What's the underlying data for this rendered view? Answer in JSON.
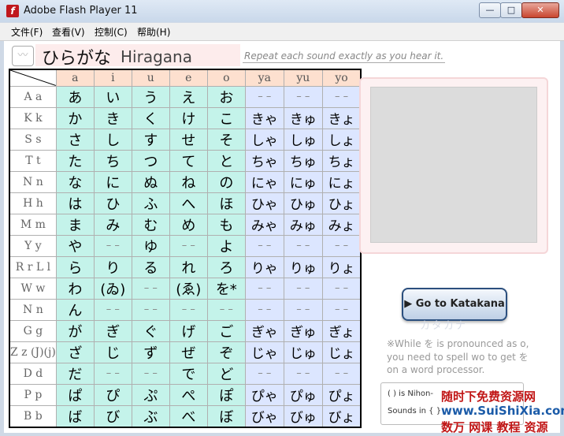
{
  "window": {
    "title": "Adobe Flash Player 11",
    "app_icon": "f",
    "min": "—",
    "max": "□",
    "close": "✕"
  },
  "menu": [
    "文件(F)",
    "查看(V)",
    "控制(C)",
    "帮助(H)"
  ],
  "header": {
    "icon": "〰",
    "title_kana": "ひらがな",
    "title_latin": "Hiragana",
    "instruction": "Repeat each sound exactly as you hear it."
  },
  "table": {
    "columns": [
      "a",
      "i",
      "u",
      "e",
      "o",
      "ya",
      "yu",
      "yo"
    ],
    "rows": [
      {
        "label": "A a",
        "cells": [
          "あ",
          "い",
          "う",
          "え",
          "お",
          "– –",
          "– –",
          "– –"
        ]
      },
      {
        "label": "K k",
        "cells": [
          "か",
          "き",
          "く",
          "け",
          "こ",
          "きゃ",
          "きゅ",
          "きょ"
        ]
      },
      {
        "label": "S s",
        "cells": [
          "さ",
          "し",
          "す",
          "せ",
          "そ",
          "しゃ",
          "しゅ",
          "しょ"
        ]
      },
      {
        "label": "T t",
        "cells": [
          "た",
          "ち",
          "つ",
          "て",
          "と",
          "ちゃ",
          "ちゅ",
          "ちょ"
        ]
      },
      {
        "label": "N n",
        "cells": [
          "な",
          "に",
          "ぬ",
          "ね",
          "の",
          "にゃ",
          "にゅ",
          "にょ"
        ]
      },
      {
        "label": "H h",
        "cells": [
          "は",
          "ひ",
          "ふ",
          "へ",
          "ほ",
          "ひゃ",
          "ひゅ",
          "ひょ"
        ]
      },
      {
        "label": "M m",
        "cells": [
          "ま",
          "み",
          "む",
          "め",
          "も",
          "みゃ",
          "みゅ",
          "みょ"
        ]
      },
      {
        "label": "Y y",
        "cells": [
          "や",
          "– –",
          "ゆ",
          "– –",
          "よ",
          "– –",
          "– –",
          "– –"
        ]
      },
      {
        "label": "R r L l",
        "cells": [
          "ら",
          "り",
          "る",
          "れ",
          "ろ",
          "りゃ",
          "りゅ",
          "りょ"
        ]
      },
      {
        "label": "W w",
        "cells": [
          "わ",
          "(ゐ)",
          "– –",
          "(ゑ)",
          "を*",
          "– –",
          "– –",
          "– –"
        ]
      },
      {
        "label": "N n",
        "cells": [
          "ん",
          "– –",
          "– –",
          "– –",
          "– –",
          "– –",
          "– –",
          "– –"
        ]
      },
      {
        "label": "G g",
        "cells": [
          "が",
          "ぎ",
          "ぐ",
          "げ",
          "ご",
          "ぎゃ",
          "ぎゅ",
          "ぎょ"
        ]
      },
      {
        "label": "Z z (J)(j)",
        "cells": [
          "ざ",
          "じ",
          "ず",
          "ぜ",
          "ぞ",
          "じゃ",
          "じゅ",
          "じょ"
        ]
      },
      {
        "label": "D d",
        "cells": [
          "だ",
          "– –",
          "– –",
          "で",
          "ど",
          "– –",
          "– –",
          "– –"
        ]
      },
      {
        "label": "P p",
        "cells": [
          "ぱ",
          "ぴ",
          "ぷ",
          "ぺ",
          "ぽ",
          "ぴゃ",
          "ぴゅ",
          "ぴょ"
        ]
      },
      {
        "label": "B b",
        "cells": [
          "ば",
          "び",
          "ぶ",
          "べ",
          "ぼ",
          "びゃ",
          "びゅ",
          "びょ"
        ]
      }
    ]
  },
  "katakana_button": {
    "label": "▶ Go to Katakana",
    "ghost": "カタカナ"
  },
  "note": {
    "line1": "※While を is pronounced as o,",
    "line2": "you need to spell wo to get を",
    "line3": "on a word processor."
  },
  "nihon_box": {
    "line1": "( ) is Nihon-",
    "line2": "Sounds in { }"
  },
  "watermark": {
    "line1": "随时下免费资源网",
    "line2": "www.SuiShiXia.com",
    "line3": "数万 网课 教程 资源"
  }
}
